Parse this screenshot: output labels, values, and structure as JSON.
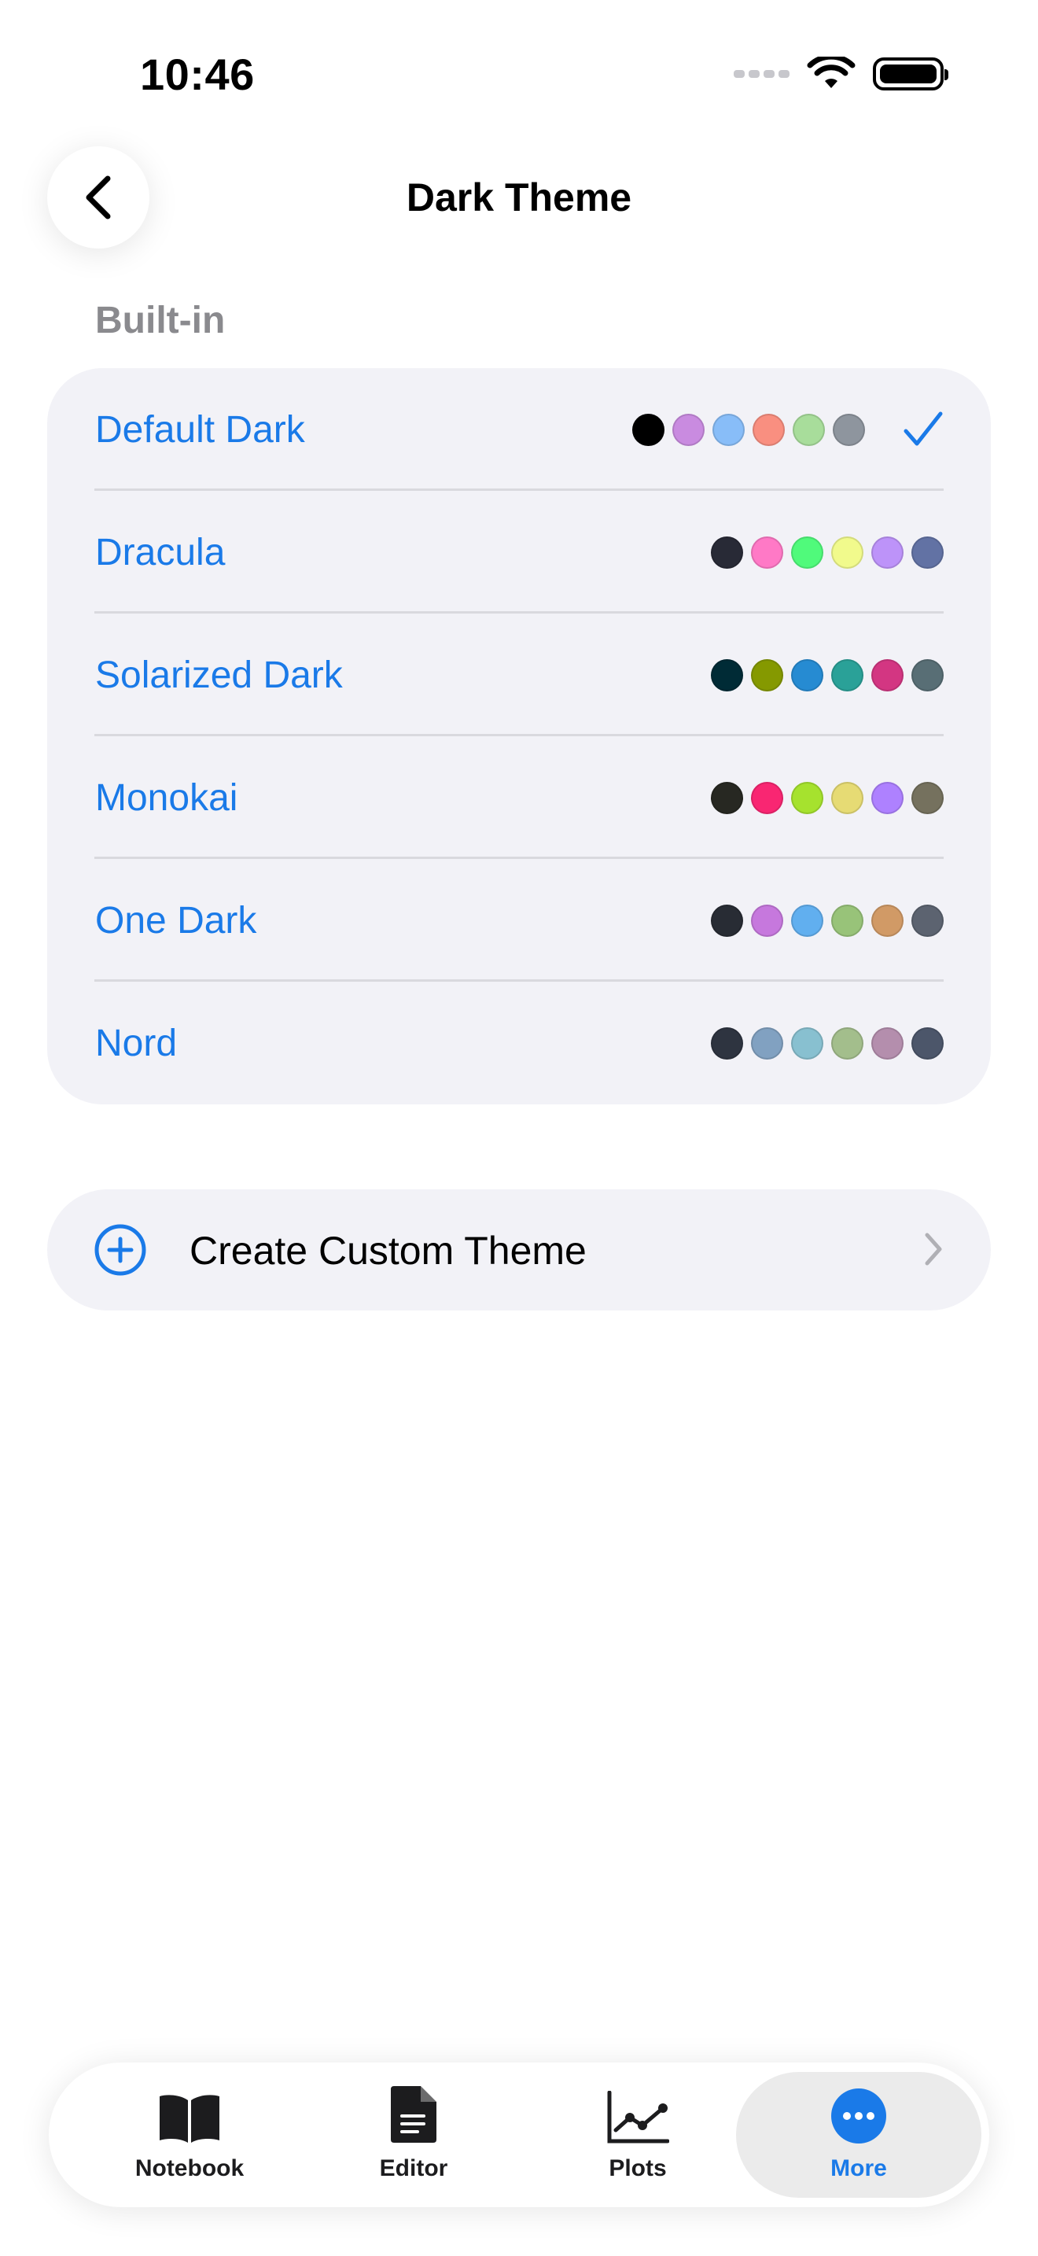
{
  "status_bar": {
    "time": "10:46"
  },
  "nav": {
    "title": "Dark Theme"
  },
  "section": {
    "header": "Built-in"
  },
  "accent": "#1a7ae8",
  "themes": [
    {
      "name": "Default Dark",
      "selected": true,
      "colors": [
        "#000000",
        "#c98be0",
        "#88bdf8",
        "#f98f80",
        "#a8dd9b",
        "#8e959e"
      ]
    },
    {
      "name": "Dracula",
      "selected": false,
      "colors": [
        "#282a36",
        "#ff79c6",
        "#50fa7b",
        "#f1fa8c",
        "#bd93f9",
        "#6272a4"
      ]
    },
    {
      "name": "Solarized Dark",
      "selected": false,
      "colors": [
        "#002b36",
        "#859900",
        "#268bd2",
        "#2aa198",
        "#d33682",
        "#586e75"
      ]
    },
    {
      "name": "Monokai",
      "selected": false,
      "colors": [
        "#272822",
        "#f92672",
        "#a6e22e",
        "#e6db74",
        "#ae81ff",
        "#75715e"
      ]
    },
    {
      "name": "One Dark",
      "selected": false,
      "colors": [
        "#282c34",
        "#c678dd",
        "#61afef",
        "#98c379",
        "#d19a66",
        "#5c6370"
      ]
    },
    {
      "name": "Nord",
      "selected": false,
      "colors": [
        "#2e3440",
        "#81a1c1",
        "#88c0d0",
        "#a3be8c",
        "#b48ead",
        "#4c566a"
      ]
    }
  ],
  "create": {
    "label": "Create Custom Theme",
    "icon": "plus-circle-icon"
  },
  "tabs": [
    {
      "label": "Notebook",
      "icon": "book-icon",
      "selected": false
    },
    {
      "label": "Editor",
      "icon": "document-icon",
      "selected": false
    },
    {
      "label": "Plots",
      "icon": "chart-icon",
      "selected": false
    },
    {
      "label": "More",
      "icon": "ellipsis-icon",
      "selected": true
    }
  ]
}
